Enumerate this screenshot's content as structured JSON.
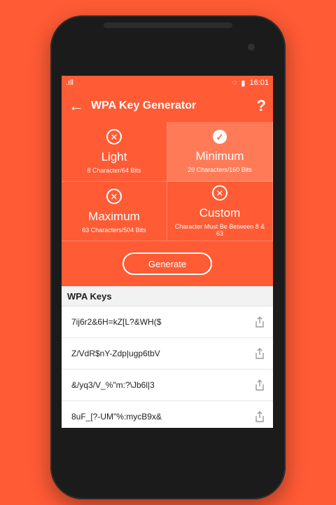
{
  "status_bar": {
    "signal": ".ıll",
    "time": "16:01"
  },
  "appbar": {
    "title": "WPA Key Generator",
    "back_icon": "←",
    "help_icon": "?"
  },
  "options": [
    {
      "name": "Light",
      "desc": "8 Character/64 Bits",
      "selected": false
    },
    {
      "name": "Minimum",
      "desc": "20 Characters/160 Bits",
      "selected": true
    },
    {
      "name": "Maximum",
      "desc": "63 Characters/504 Bits",
      "selected": false
    },
    {
      "name": "Custom",
      "desc": "Character Must Be Between 8 & 63",
      "selected": false
    }
  ],
  "generate_label": "Generate",
  "keys_title": "WPA Keys",
  "keys": [
    "7ij6r2&6H=kZ[L?&WH($",
    "Z/VdR$nY-Zdp|ugp6tbV",
    "&/yq3/V_%\"m:?\\Jb6l|3",
    "8uF_[?-UM\"%:mycB9x&"
  ],
  "colors": {
    "accent": "#FF5B35",
    "selected": "#FF7B58"
  }
}
